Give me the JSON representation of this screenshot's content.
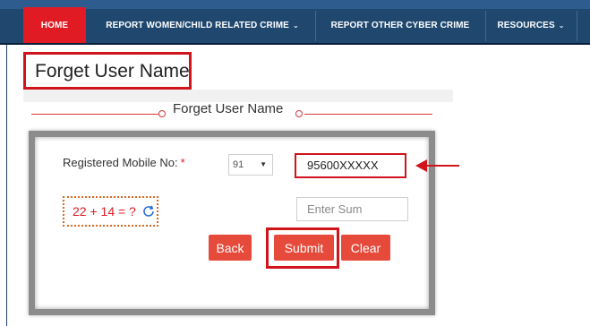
{
  "nav": {
    "home": "HOME",
    "women_child": "REPORT WOMEN/CHILD RELATED CRIME",
    "other_cyber": "REPORT OTHER CYBER CRIME",
    "resources": "RESOURCES",
    "caret": "⌄"
  },
  "page": {
    "title": "Forget User Name"
  },
  "form": {
    "legend": "Forget User Name",
    "mobile_label": "Registered Mobile No:",
    "required_mark": "*",
    "country_code": "91",
    "mobile_value": "95600XXXXX",
    "captcha": "22 + 14 = ?",
    "sum_placeholder": "Enter Sum",
    "back_label": "Back",
    "submit_label": "Submit",
    "clear_label": "Clear"
  },
  "colors": {
    "accent_red": "#e01b24",
    "button_red": "#e64a3b",
    "nav_blue": "#20486f",
    "highlight_red": "#d0141c"
  }
}
